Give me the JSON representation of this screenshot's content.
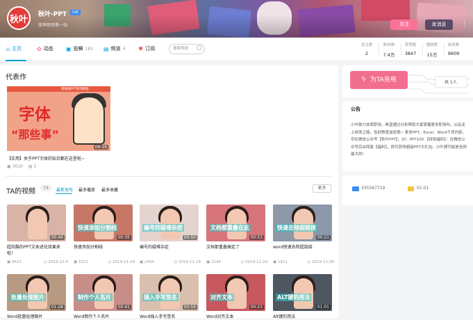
{
  "header": {
    "avatar_text": "秋叶",
    "username": "秋叶-PPT",
    "level_badge": "LV6",
    "sign": "效率职场第一站",
    "follow_label": "关注",
    "message_label": "发消息",
    "more_icon": "more-vertical-icon"
  },
  "nav": {
    "tabs": [
      {
        "label": "主页",
        "icon": "home-icon"
      },
      {
        "label": "动态",
        "icon": "dynamic-icon"
      },
      {
        "label": "投稿",
        "count": "183",
        "icon": "upload-icon"
      },
      {
        "label": "频道",
        "count": "4",
        "icon": "channel-icon"
      },
      {
        "label": "订阅",
        "icon": "subscribe-icon"
      }
    ],
    "search_placeholder": "搜索视频"
  },
  "stats": [
    {
      "label": "关注数",
      "value": "2"
    },
    {
      "label": "粉丝数",
      "value": "7.4万"
    },
    {
      "label": "获赞数",
      "value": "3847"
    },
    {
      "label": "播放数",
      "value": "15万"
    },
    {
      "label": "阅读数",
      "value": "9609"
    }
  ],
  "masterpiece": {
    "section_title": "代表作",
    "banner_text": "零基础PPT系列教程",
    "big_text_1": "字体",
    "big_text_2": "“那些事”",
    "duration": "06:16",
    "title": "【实用】关于PPT字体的知识都在这里啦~",
    "views": "3619",
    "comments": "5"
  },
  "videos_section": {
    "title": "TA的视频",
    "count": "74",
    "sort_options": [
      "最新发布",
      "最多播放",
      "最多收藏"
    ],
    "more_label": "更多"
  },
  "videos": [
    {
      "caption": "",
      "duration": "00:46",
      "title": "超炫酷的PPT文本进化效果来啦！",
      "views": "8621",
      "date": "2019-12-4",
      "bg": "#d9b3a6"
    },
    {
      "caption": "快速添加分割线",
      "duration": "00:35",
      "title": "快速添加分割线",
      "views": "5213",
      "date": "2019-11-29",
      "bg": "#c77766"
    },
    {
      "caption": "编号的疑难杂症",
      "duration": "00:50",
      "title": "编号的疑难杂症",
      "views": "2494",
      "date": "2019-11-29",
      "bg": "#e5d3cf"
    },
    {
      "caption": "文档都重叠在此",
      "duration": "00:53",
      "title": "文档那重叠搞定了",
      "views": "2144",
      "date": "2019-11-29",
      "bg": "#d6747a"
    },
    {
      "caption": "快速去除超链接",
      "duration": "00:21",
      "title": "word快速去除超链接",
      "views": "1911",
      "date": "2019-11-28",
      "bg": "#8d98a8"
    },
    {
      "caption": "批量处理图片",
      "duration": "01:28",
      "title": "Word批量处理图片",
      "views": "",
      "date": "",
      "bg": "#b89a82"
    },
    {
      "caption": "制作个人名片",
      "duration": "00:41",
      "title": "Word制作个人名片",
      "views": "",
      "date": "",
      "bg": "#c98d88"
    },
    {
      "caption": "插入手写签名",
      "duration": "00:59",
      "title": "Word插入手写签名",
      "views": "",
      "date": "",
      "bg": "#d9bfae"
    },
    {
      "caption": "对齐文本",
      "duration": "00:23",
      "title": "Word对齐文本",
      "views": "",
      "date": "",
      "bg": "#c7595e"
    },
    {
      "caption": "ALT键的用法",
      "duration": "01:01",
      "title": "Alt键的用法",
      "views": "",
      "date": "",
      "bg": "#4e5660"
    }
  ],
  "sidebar": {
    "charge_label": "为TA充电",
    "charge_total": "共 1人",
    "notice_title": "公告",
    "notice_text": "小叶致力效率职场，希望通过分析帮助大家掌握更多职场叫，从此走上效率之路，告别熬夜加班哦~ 更多PPT、Excel、Word干货内容，尽在微信公众号【秋叶PPT】，ID：PPT100 【特别福利】：在微信公众号后台回复【福利】，即可获得超级PPT大礼包。小叶搏可能是全网最大的!",
    "uid": "335567719",
    "birthday": "01-01"
  },
  "colors": {
    "accent": "#00a1d6",
    "pink": "#fb7299",
    "charge": "#f26e8e"
  }
}
